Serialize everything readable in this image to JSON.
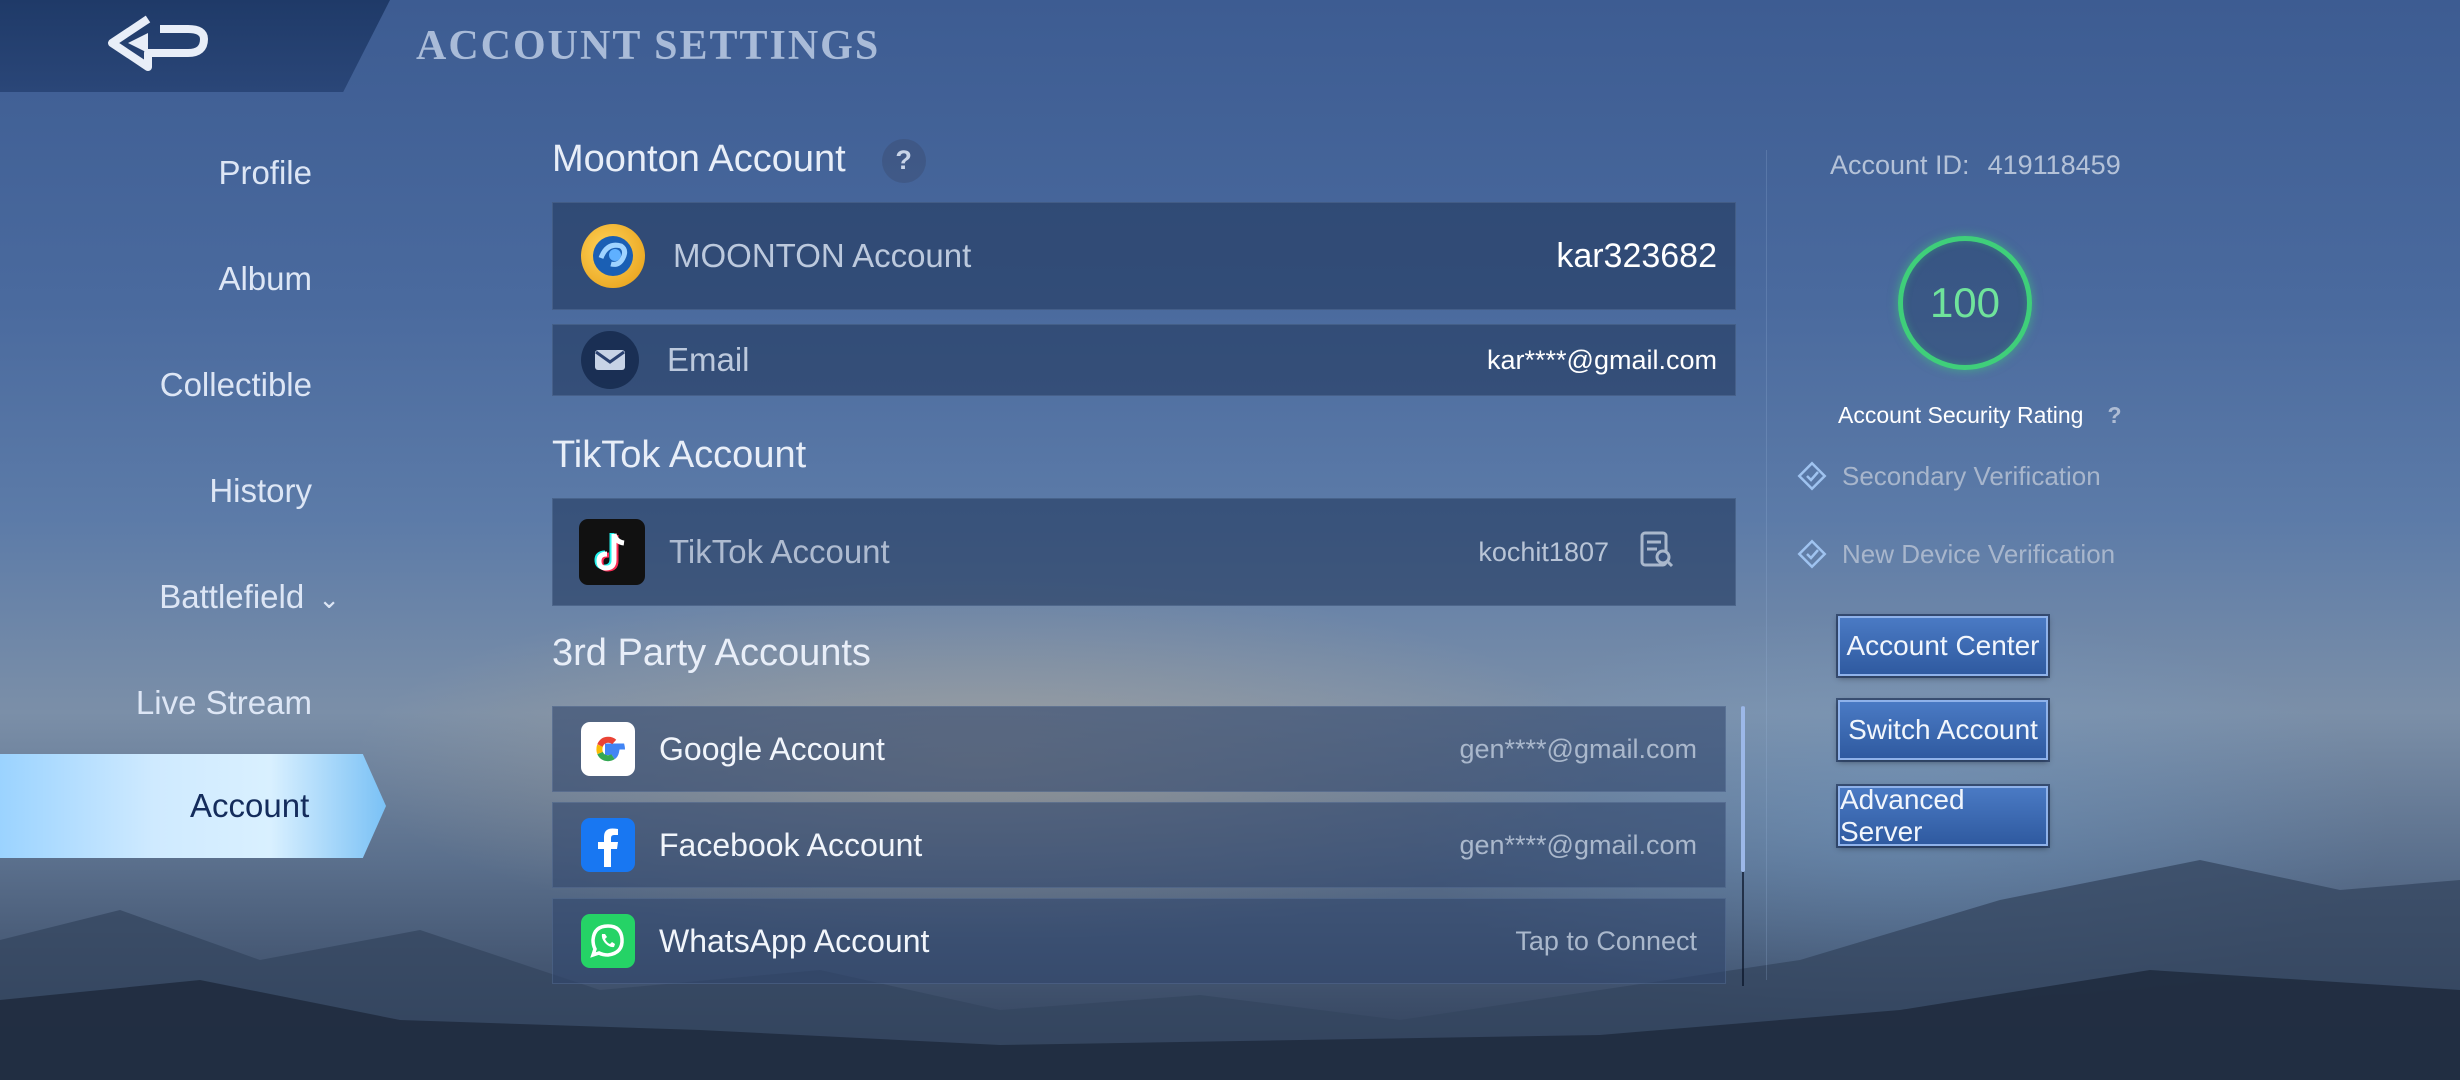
{
  "header": {
    "title": "ACCOUNT SETTINGS"
  },
  "nav": {
    "items": [
      {
        "label": "Profile"
      },
      {
        "label": "Album"
      },
      {
        "label": "Collectible"
      },
      {
        "label": "History"
      },
      {
        "label": "Battlefield"
      },
      {
        "label": "Live Stream"
      },
      {
        "label": "Account"
      }
    ],
    "active": "Account"
  },
  "moonton": {
    "title": "Moonton Account",
    "help": "?",
    "account_label": "MOONTON Account",
    "account_value": "kar323682",
    "email_label": "Email",
    "email_value": "kar****@gmail.com"
  },
  "tiktok": {
    "title": "TikTok Account",
    "label": "TikTok Account",
    "value": "kochit1807"
  },
  "third_party": {
    "title": "3rd Party Accounts",
    "items": [
      {
        "label": "Google Account",
        "value": "gen****@gmail.com",
        "icon": "google-icon"
      },
      {
        "label": "Facebook Account",
        "value": "gen****@gmail.com",
        "icon": "facebook-icon"
      },
      {
        "label": "WhatsApp Account",
        "value": "Tap to Connect",
        "icon": "whatsapp-icon"
      }
    ]
  },
  "right": {
    "account_id_label": "Account ID:",
    "account_id_value": "419118459",
    "security_score": "100",
    "security_label": "Account Security Rating",
    "security_help": "?",
    "secondary_verification": "Secondary Verification",
    "new_device_verification": "New Device Verification",
    "buttons": {
      "account_center": "Account Center",
      "switch_account": "Switch Account",
      "advanced_server": "Advanced Server"
    }
  },
  "colors": {
    "rating_green": "#3fcf7a",
    "button_blue": "#3a68b2",
    "active_nav": "#cfeaff"
  }
}
